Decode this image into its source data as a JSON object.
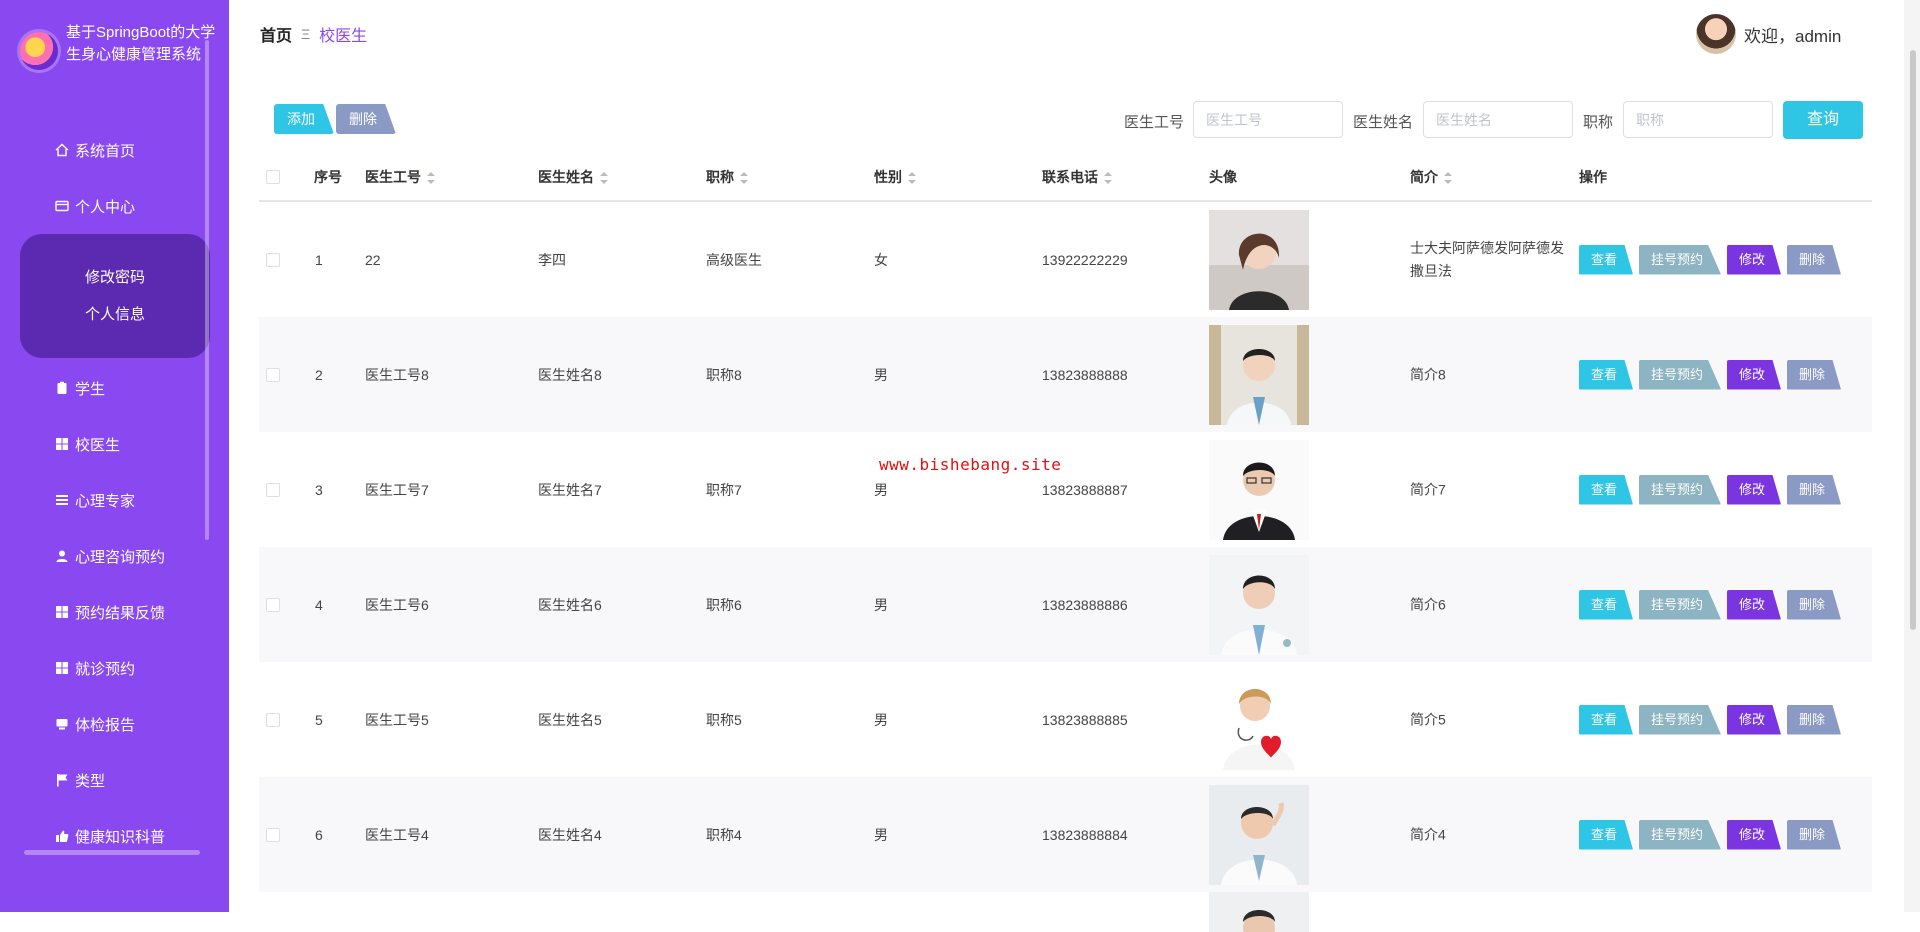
{
  "app": {
    "title": "基于SpringBoot的大学生身心健康管理系统"
  },
  "sidebar": {
    "items": [
      {
        "label": "系统首页",
        "icon": "home-icon"
      },
      {
        "label": "个人中心",
        "icon": "card-icon"
      },
      {
        "label": "学生",
        "icon": "clipboard-icon"
      },
      {
        "label": "校医生",
        "icon": "grid-icon"
      },
      {
        "label": "心理专家",
        "icon": "list-icon"
      },
      {
        "label": "心理咨询预约",
        "icon": "user-icon"
      },
      {
        "label": "预约结果反馈",
        "icon": "grid-icon"
      },
      {
        "label": "就诊预约",
        "icon": "grid-icon"
      },
      {
        "label": "体检报告",
        "icon": "monitor-icon"
      },
      {
        "label": "类型",
        "icon": "flag-icon"
      },
      {
        "label": "健康知识科普",
        "icon": "thumb-icon"
      }
    ],
    "submenu": [
      {
        "label": "修改密码"
      },
      {
        "label": "个人信息"
      }
    ]
  },
  "header": {
    "breadcrumb_home": "首页",
    "breadcrumb_sep": "Ξ",
    "breadcrumb_current": "校医生",
    "welcome": "欢迎，admin"
  },
  "toolbar": {
    "add": "添加",
    "delete": "删除",
    "search": {
      "id_label": "医生工号",
      "id_placeholder": "医生工号",
      "name_label": "医生姓名",
      "name_placeholder": "医生姓名",
      "title_label": "职称",
      "title_placeholder": "职称",
      "query": "查询"
    }
  },
  "table": {
    "columns": [
      "序号",
      "医生工号",
      "医生姓名",
      "职称",
      "性别",
      "联系电话",
      "头像",
      "简介",
      "操作"
    ],
    "actions": {
      "view": "查看",
      "book": "挂号预约",
      "edit": "修改",
      "delete": "删除"
    },
    "rows": [
      {
        "no": "1",
        "id": "22",
        "name": "李四",
        "title": "高级医生",
        "gender": "女",
        "phone": "13922222229",
        "intro": "士大夫阿萨德发阿萨德发撒旦法"
      },
      {
        "no": "2",
        "id": "医生工号8",
        "name": "医生姓名8",
        "title": "职称8",
        "gender": "男",
        "phone": "13823888888",
        "intro": "简介8"
      },
      {
        "no": "3",
        "id": "医生工号7",
        "name": "医生姓名7",
        "title": "职称7",
        "gender": "男",
        "phone": "13823888887",
        "intro": "简介7"
      },
      {
        "no": "4",
        "id": "医生工号6",
        "name": "医生姓名6",
        "title": "职称6",
        "gender": "男",
        "phone": "13823888886",
        "intro": "简介6"
      },
      {
        "no": "5",
        "id": "医生工号5",
        "name": "医生姓名5",
        "title": "职称5",
        "gender": "男",
        "phone": "13823888885",
        "intro": "简介5"
      },
      {
        "no": "6",
        "id": "医生工号4",
        "name": "医生姓名4",
        "title": "职称4",
        "gender": "男",
        "phone": "13823888884",
        "intro": "简介4"
      }
    ]
  },
  "watermark": "www.bishebang.site",
  "colors": {
    "sidebar": "#8a48f1",
    "submenu": "#5b2ab0",
    "primary": "#2fc6e6",
    "edit": "#7b35e0",
    "muted": "#8b9ac4",
    "book": "#8db4c2"
  }
}
